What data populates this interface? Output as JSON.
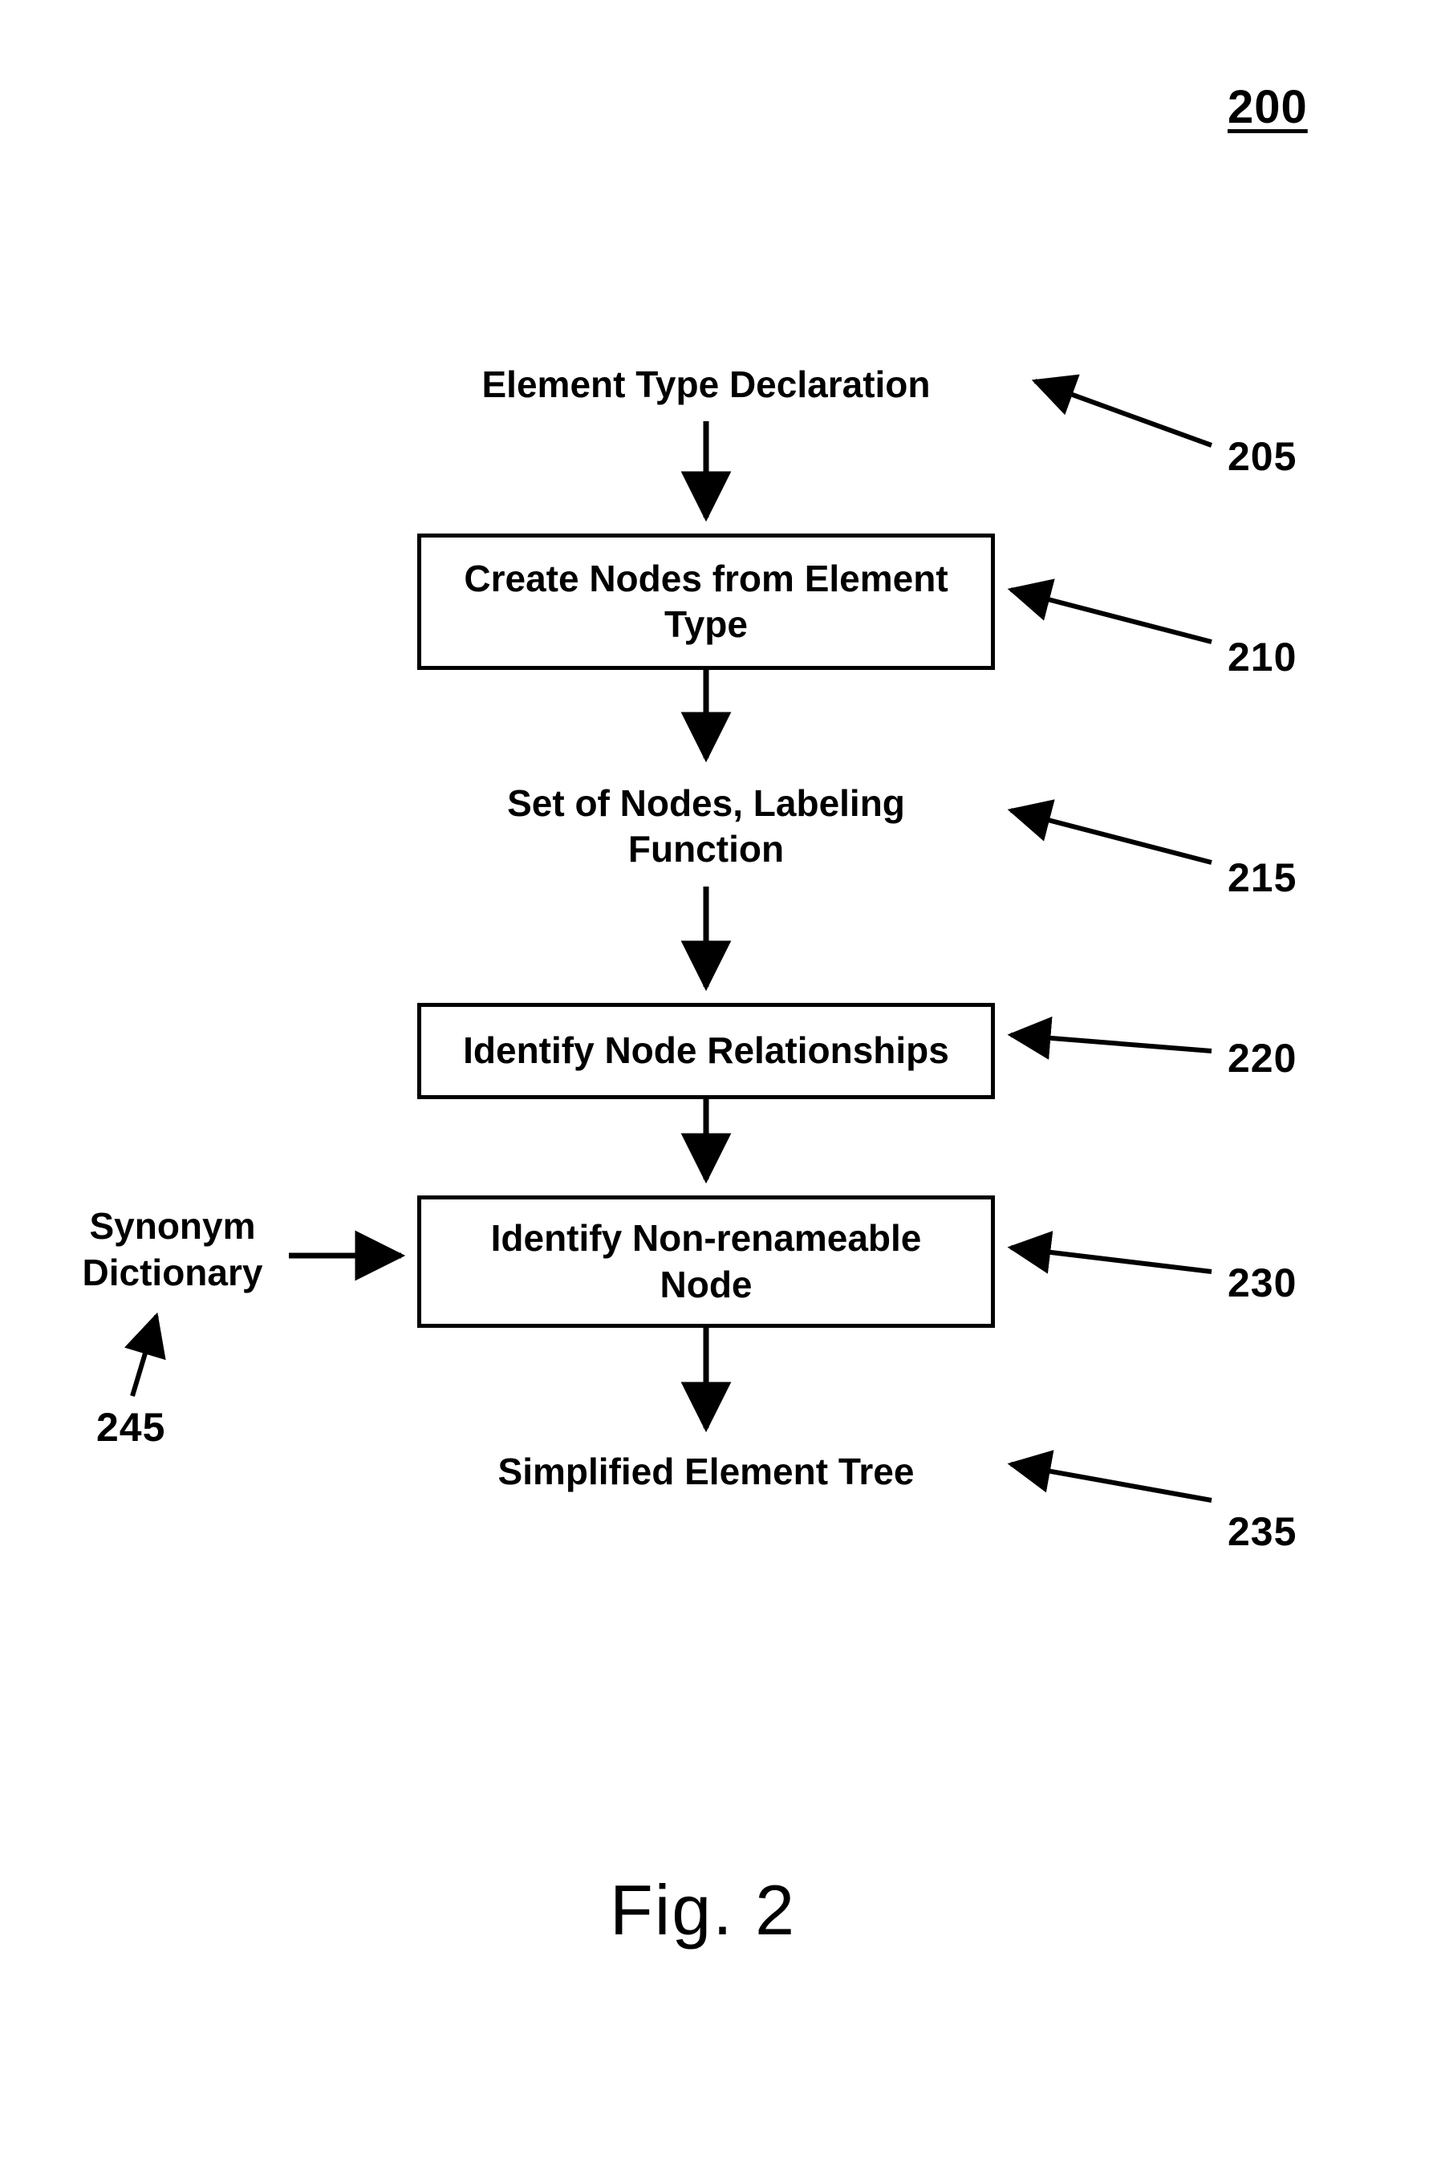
{
  "chart_data": {
    "type": "flowchart",
    "title": "Fig. 2",
    "figure_number": "200",
    "nodes": [
      {
        "id": "205",
        "kind": "io",
        "label": "Element Type Declaration"
      },
      {
        "id": "210",
        "kind": "process",
        "label": "Create Nodes from Element\nType"
      },
      {
        "id": "215",
        "kind": "io",
        "label": "Set of Nodes, Labeling\nFunction"
      },
      {
        "id": "220",
        "kind": "process",
        "label": "Identify Node Relationships"
      },
      {
        "id": "230",
        "kind": "process",
        "label": "Identify Non-renameable\nNode"
      },
      {
        "id": "235",
        "kind": "io",
        "label": "Simplified Element Tree"
      },
      {
        "id": "245",
        "kind": "side",
        "label": "Synonym\nDictionary"
      }
    ],
    "edges": [
      {
        "from": "205",
        "to": "210"
      },
      {
        "from": "210",
        "to": "215"
      },
      {
        "from": "215",
        "to": "220"
      },
      {
        "from": "220",
        "to": "230"
      },
      {
        "from": "230",
        "to": "235"
      },
      {
        "from": "245",
        "to": "230"
      }
    ],
    "reference_labels": [
      "200",
      "205",
      "210",
      "215",
      "220",
      "230",
      "235",
      "245"
    ]
  },
  "labels": {
    "figNum": "200",
    "n205": "Element Type Declaration",
    "n210": "Create Nodes from Element\nType",
    "n215": "Set of Nodes, Labeling\nFunction",
    "n220": "Identify Node Relationships",
    "n230": "Identify Non-renameable\nNode",
    "n235": "Simplified Element Tree",
    "n245": "Synonym\nDictionary",
    "r205": "205",
    "r210": "210",
    "r215": "215",
    "r220": "220",
    "r230": "230",
    "r235": "235",
    "r245": "245",
    "caption": "Fig. 2"
  }
}
